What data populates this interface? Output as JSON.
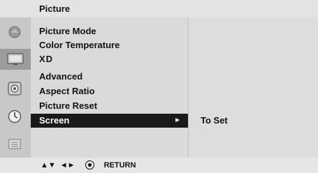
{
  "menu": {
    "title": "Picture",
    "items": [
      {
        "label": "Picture Mode"
      },
      {
        "label": "Color Temperature"
      },
      {
        "label": "XD"
      },
      {
        "label": "Advanced"
      },
      {
        "label": "Aspect Ratio"
      },
      {
        "label": "Picture Reset"
      }
    ],
    "selected": {
      "label": "Screen",
      "arrow": "►"
    },
    "submenu_hint": "To Set"
  },
  "side_icons": [
    "setup-icon",
    "picture-icon",
    "sound-icon",
    "time-icon",
    "option-icon"
  ],
  "footer": {
    "nav_arrows_vertical": "▲▼",
    "nav_arrows_horizontal": "◄►",
    "ok_icon": "ok-icon",
    "return_label": "RETURN"
  },
  "colors": {
    "selected_background": "#1a1a1a",
    "selected_text": "#ffffff"
  }
}
